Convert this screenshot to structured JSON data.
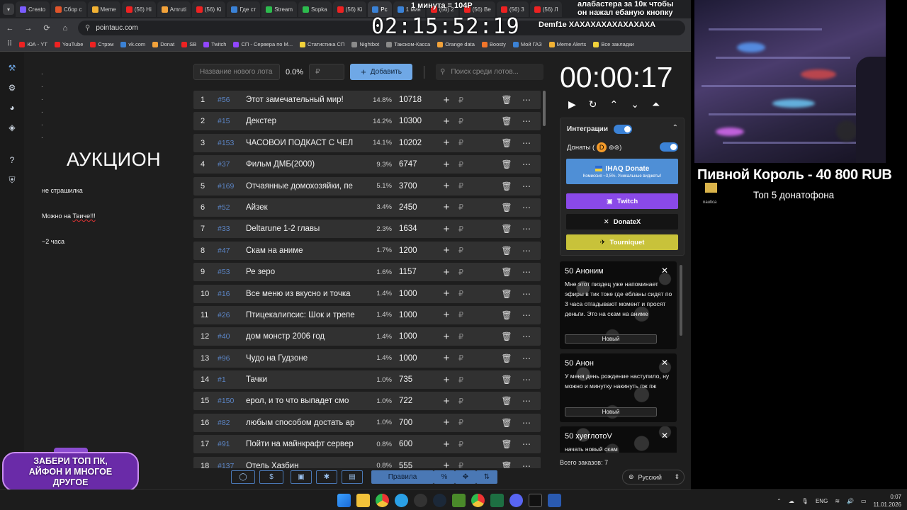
{
  "browser": {
    "tabs": [
      {
        "label": "Creato",
        "color": "#7a5cff"
      },
      {
        "label": "Сбор с",
        "color": "#e0552b"
      },
      {
        "label": "Meme",
        "color": "#f2b234"
      },
      {
        "label": "(56) Hi",
        "color": "#e22"
      },
      {
        "label": "Amruti",
        "color": "#f2a23a"
      },
      {
        "label": "(56) Ki",
        "color": "#e22"
      },
      {
        "label": "Где ст",
        "color": "#3b82d6"
      },
      {
        "label": "Stream",
        "color": "#2dbb4e"
      },
      {
        "label": "Sopka",
        "color": "#2dbb4e"
      },
      {
        "label": "(56) Ki",
        "color": "#e22"
      },
      {
        "label": "Рс",
        "color": "#3b82d6"
      },
      {
        "label": "1 мин",
        "color": "#3b82d6"
      },
      {
        "label": "(56) 2",
        "color": "#e22"
      },
      {
        "label": "(56) Be",
        "color": "#e22"
      },
      {
        "label": "(56) 3",
        "color": "#e22"
      },
      {
        "label": "(56) Л",
        "color": "#e22"
      }
    ],
    "url": "pointauc.com",
    "bookmarks": [
      {
        "label": "ЮА - YT",
        "color": "#e22"
      },
      {
        "label": "YouTube",
        "color": "#e22"
      },
      {
        "label": "Стрэм",
        "color": "#e22"
      },
      {
        "label": "vk.com",
        "color": "#3b82d6"
      },
      {
        "label": "Donat",
        "color": "#f2a23a"
      },
      {
        "label": "SB",
        "color": "#e22"
      },
      {
        "label": "Twitch",
        "color": "#9146ff"
      },
      {
        "label": "СП - Сервера по М...",
        "color": "#9146ff"
      },
      {
        "label": "Статистика СП",
        "color": "#f2d23a"
      },
      {
        "label": "Nightbot",
        "color": "#8a8a8a"
      },
      {
        "label": "Такском-Касса",
        "color": "#8a8a8a"
      },
      {
        "label": "Orange data",
        "color": "#f2a23a"
      },
      {
        "label": "Boosty",
        "color": "#f2752a"
      },
      {
        "label": "Мой ГАЗ",
        "color": "#3b82d6"
      },
      {
        "label": "Meme Alerts",
        "color": "#f2b234"
      },
      {
        "label": "Все закладки",
        "color": "#f2d23a"
      }
    ]
  },
  "overlay": {
    "timer": "02:15:52:19",
    "top_label": "1 минута = 104Р",
    "msg_line1": "алабастера за 10к чтобы",
    "msg_line2": "он нажал ебаную кнопку",
    "msg_line3": "Demf1e ХАХАХАХАХАХАХАХА"
  },
  "left_panel": {
    "title": "АУКЦИОН",
    "line1": "не страшилка",
    "line2_prefix": "Можно на",
    "line2_link": "Твиче!!!",
    "line3": "~2 часа"
  },
  "controls": {
    "new_lot_placeholder": "Название нового лота",
    "percent": "0.0%",
    "currency_placeholder": "₽",
    "add_label": "Добавить",
    "search_placeholder": "Поиск среди лотов..."
  },
  "lots": [
    {
      "n": "1",
      "id": "#56",
      "name": "Этот замечательный мир!",
      "pct": "14.8%",
      "amount": "10718"
    },
    {
      "n": "2",
      "id": "#15",
      "name": "Декстер",
      "pct": "14.2%",
      "amount": "10300"
    },
    {
      "n": "3",
      "id": "#153",
      "name": " ЧАСОВОЙ ПОДКАСТ С ЧЕЛ",
      "pct": "14.1%",
      "amount": "10202"
    },
    {
      "n": "4",
      "id": "#37",
      "name": "Фильм ДМБ(2000)",
      "pct": "9.3%",
      "amount": "6747"
    },
    {
      "n": "5",
      "id": "#169",
      "name": " Отчаянные домохозяйки, пе",
      "pct": "5.1%",
      "amount": "3700"
    },
    {
      "n": "6",
      "id": "#52",
      "name": "Айзек",
      "pct": "3.4%",
      "amount": "2450"
    },
    {
      "n": "7",
      "id": "#33",
      "name": "Deltarune 1-2 главы",
      "pct": "2.3%",
      "amount": "1634"
    },
    {
      "n": "8",
      "id": "#47",
      "name": "Скам на аниме",
      "pct": "1.7%",
      "amount": "1200"
    },
    {
      "n": "9",
      "id": "#53",
      "name": "Ре зеро",
      "pct": "1.6%",
      "amount": "1157"
    },
    {
      "n": "10",
      "id": "#16",
      "name": "Все меню из вкусно и точка",
      "pct": "1.4%",
      "amount": "1000"
    },
    {
      "n": "11",
      "id": "#26",
      "name": "Птицекалипсис: Шок и трепе",
      "pct": "1.4%",
      "amount": "1000"
    },
    {
      "n": "12",
      "id": "#40",
      "name": "дом монстр 2006 год",
      "pct": "1.4%",
      "amount": "1000"
    },
    {
      "n": "13",
      "id": "#96",
      "name": "Чудо на Гудзоне",
      "pct": "1.4%",
      "amount": "1000"
    },
    {
      "n": "14",
      "id": "#1",
      "name": "Тачки",
      "pct": "1.0%",
      "amount": "735"
    },
    {
      "n": "15",
      "id": "#150",
      "name": " ерол, и то что выпадет смо",
      "pct": "1.0%",
      "amount": "722"
    },
    {
      "n": "16",
      "id": "#82",
      "name": "любым способом достать ар",
      "pct": "1.0%",
      "amount": "700"
    },
    {
      "n": "17",
      "id": "#91",
      "name": "Пойти на майнкрафт сервер",
      "pct": "0.8%",
      "amount": "600"
    },
    {
      "n": "18",
      "id": "#137",
      "name": "Отель Хазбин",
      "pct": "0.8%",
      "amount": "555"
    }
  ],
  "row_icons": {
    "plus": "+",
    "rub": "₽",
    "trash": "🗑",
    "more": "⋯"
  },
  "bottombar": {
    "rules": "Правила",
    "percent": "%"
  },
  "right_panel": {
    "timer": "00:00:17",
    "integrations": "Интеграции",
    "donations": "Донаты (",
    "ihaq": "IHAQ Donate",
    "ihaq_sub": "Комиссия ~3,5%. Уникальные виджеты!",
    "twitch": "Twitch",
    "donatex": "DonateX",
    "tourniquet": "Tourniquet",
    "donations_list": [
      {
        "head": "50 Аноним",
        "body": "Мне этот пиздец уже напоминает эфиры в тик токе где ебланы сидят по 3 часа отгадывают момент и просят деньги. Это на скам на аниме",
        "badge": "Новый"
      },
      {
        "head": "50 Анон",
        "body": "У меня день рождение наступило, ну можно и минутку накинуть пж пж",
        "badge": "Новый"
      },
      {
        "head": "50 хуеглотоV",
        "body": "начать новый скам"
      }
    ],
    "orders_label": "Всего заказов:",
    "orders_count": "7",
    "language": "Русский"
  },
  "promo": {
    "text": "ЗАБЕРИ ТОП ПК, АЙФОН И МНОГОЕ ДРУГОЕ"
  },
  "stream": {
    "king": "Пивной Король - 40 800 RUB",
    "top_donate": "Топ  5 донатофона",
    "nautica": "nautica"
  },
  "taskbar": {
    "lang": "ENG",
    "time": "0:07",
    "date": "11.01.2026"
  },
  "colors": {
    "accent": "#6fa8e6",
    "twitch": "#9146ff",
    "tourniquet": "#c8c23a",
    "lot_id": "#5b84c4"
  }
}
